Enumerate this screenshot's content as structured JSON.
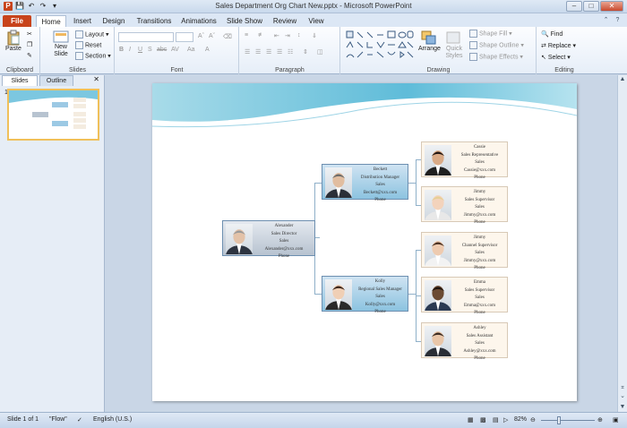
{
  "window": {
    "title": "Sales Department Org Chart New.pptx - Microsoft PowerPoint"
  },
  "tabs": [
    "File",
    "Home",
    "Insert",
    "Design",
    "Transitions",
    "Animations",
    "Slide Show",
    "Review",
    "View"
  ],
  "ribbon": {
    "clipboard": {
      "label": "Clipboard",
      "paste": "Paste"
    },
    "slides": {
      "label": "Slides",
      "new_slide": "New Slide",
      "layout": "Layout",
      "reset": "Reset",
      "section": "Section"
    },
    "font": {
      "label": "Font"
    },
    "paragraph": {
      "label": "Paragraph"
    },
    "drawing": {
      "label": "Drawing",
      "arrange": "Arrange",
      "quick_styles": "Quick Styles",
      "shape_fill": "Shape Fill",
      "shape_outline": "Shape Outline",
      "shape_effects": "Shape Effects"
    },
    "editing": {
      "label": "Editing",
      "find": "Find",
      "replace": "Replace",
      "select": "Select"
    }
  },
  "leftpane": {
    "tab_slides": "Slides",
    "tab_outline": "Outline",
    "slide_number": "1"
  },
  "org": [
    {
      "name": "Alexander",
      "title": "Sales Director",
      "dept": "Sales",
      "email": "Alexander@xxx.com",
      "phone": "Phone",
      "style": "gray"
    },
    {
      "name": "Beckett",
      "title": "Distribution  Manager",
      "dept": "Sales",
      "email": "Beckett@xxx.com",
      "phone": "Phone",
      "style": "blue"
    },
    {
      "name": "Kolly",
      "title": "Regional  Sales Manager",
      "dept": "Sales",
      "email": "Kolly@xxx.com",
      "phone": "Phone",
      "style": "blue"
    },
    {
      "name": "Cassie",
      "title": "Sales  Representative",
      "dept": "Sales",
      "email": "Cassie@xxx.com",
      "phone": "Phone",
      "style": "cream"
    },
    {
      "name": "Jimmy",
      "title": "Sales Supervisor",
      "dept": "Sales",
      "email": "Jimmy@xxx.com",
      "phone": "Phone",
      "style": "cream"
    },
    {
      "name": "Jimmy",
      "title": "Channel Supervisor",
      "dept": "Sales",
      "email": "Jimmy@xxx.com",
      "phone": "Phone",
      "style": "cream"
    },
    {
      "name": "Emma",
      "title": "Sales Supervisor",
      "dept": "Sales",
      "email": "Emma@xxx.com",
      "phone": "Phone",
      "style": "cream"
    },
    {
      "name": "Ashley",
      "title": "Sales  Assistant",
      "dept": "Sales",
      "email": "Ashley@xxx.com",
      "phone": "Phone",
      "style": "cream"
    }
  ],
  "status": {
    "slide": "Slide 1 of 1",
    "theme": "\"Flow\"",
    "language": "English (U.S.)",
    "zoom": "82%"
  },
  "colors": {
    "file_tab": "#c8431b",
    "accent": "#6fbfdc",
    "selected_thumb": "#f0c05a"
  }
}
